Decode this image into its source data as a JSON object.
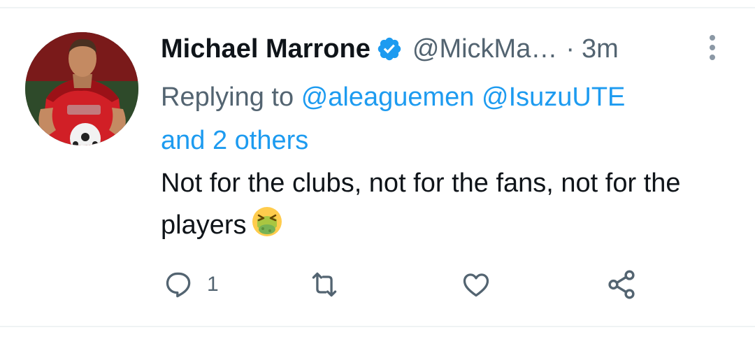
{
  "tweet": {
    "author_name": "Michael Marrone",
    "author_handle": "@MickMa…",
    "separator": "·",
    "time": "3m",
    "replying_prefix": "Replying to",
    "replying_to": [
      "@aleaguemen",
      "@IsuzuUTE"
    ],
    "replying_others": "and 2 others",
    "text": "Not for the clubs, not for the fans, not for the players",
    "emoji": "nauseated-face",
    "reply_count": "1"
  },
  "icons": {
    "verified": "verified-badge-icon",
    "more": "more-vertical-icon",
    "reply": "reply-icon",
    "retweet": "retweet-icon",
    "like": "heart-icon",
    "share": "share-icon"
  },
  "colors": {
    "link": "#1d9bf0",
    "secondary_text": "#536471",
    "primary_text": "#0f1419",
    "divider": "#eff3f4"
  }
}
